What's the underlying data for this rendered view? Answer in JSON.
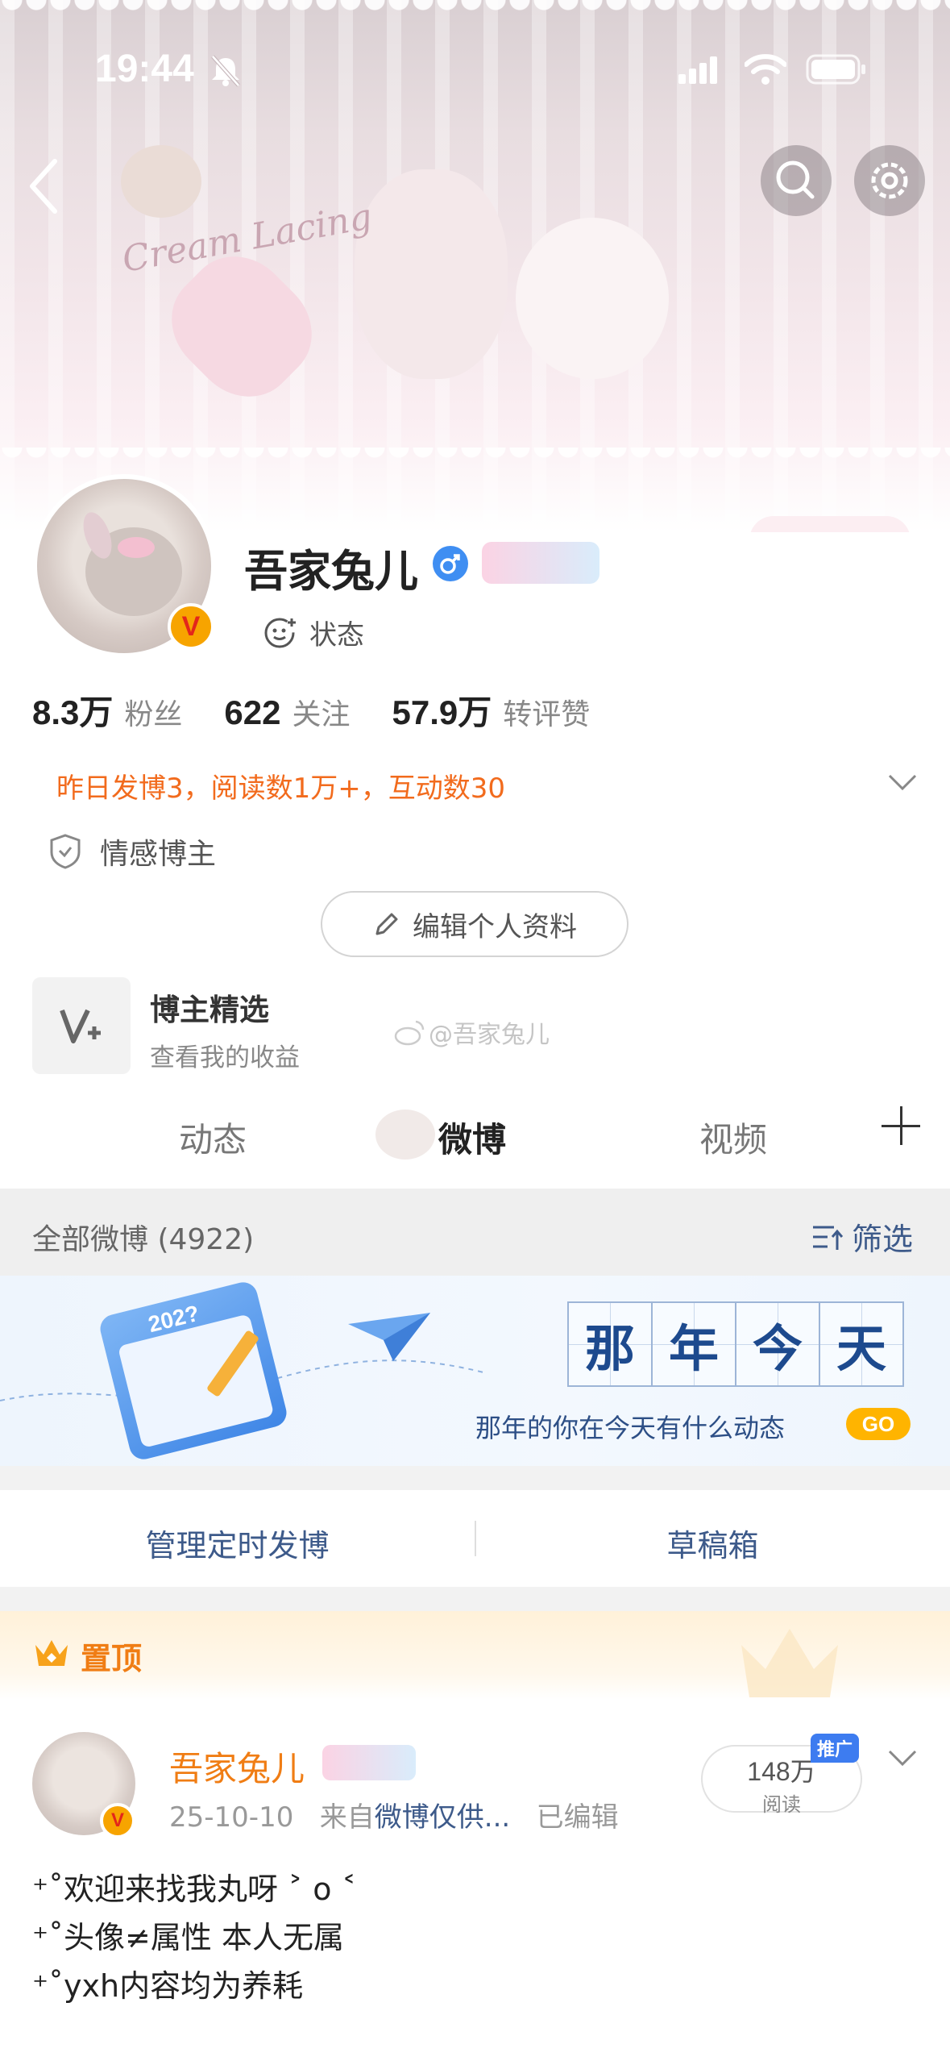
{
  "status_bar": {
    "time": "19:44"
  },
  "profile": {
    "username": "吾家兔儿",
    "status_label": "状态",
    "verified_badge": "V",
    "stats": [
      {
        "value": "8.3万",
        "label": "粉丝"
      },
      {
        "value": "622",
        "label": "关注"
      },
      {
        "value": "57.9万",
        "label": "转评赞"
      }
    ],
    "summary": "昨日发博3，阅读数1万+，互动数30",
    "tag": "情感博主",
    "edit_button": "编辑个人资料",
    "feature": {
      "title": "博主精选",
      "subtitle": "查看我的收益"
    },
    "watermark": "@吾家兔儿"
  },
  "tabs": [
    {
      "label": "动态",
      "active": false
    },
    {
      "label": "微博",
      "active": true
    },
    {
      "label": "视频",
      "active": false
    }
  ],
  "filter": {
    "all_label": "全部微博 (4922)",
    "filter_label": "筛选"
  },
  "memory_banner": {
    "chars": [
      "那",
      "年",
      "今",
      "天"
    ],
    "subtitle": "那年的你在今天有什么动态",
    "go": "GO",
    "calendar_year": "202?"
  },
  "manage": {
    "scheduled": "管理定时发博",
    "drafts": "草稿箱"
  },
  "pinned": {
    "label": "置顶",
    "post": {
      "author": "吾家兔儿",
      "date": "25-10-10",
      "source_prefix": "来自",
      "source": "微博仅供...",
      "edited": "已编辑",
      "reads_value": "148万",
      "reads_label": "阅读",
      "promo": "推广",
      "lines": [
        "⁺˚欢迎来找我丸呀 ˃ o ˂",
        "⁺˚头像≠属性 本人无属",
        "⁺˚yxh内容均为养耗"
      ]
    }
  },
  "colors": {
    "accent_orange": "#f07d14",
    "link_blue": "#3d5a8a",
    "summary_orange": "#f26b1d",
    "verified_gold": "#f7a400",
    "go_yellow": "#ffb400"
  }
}
